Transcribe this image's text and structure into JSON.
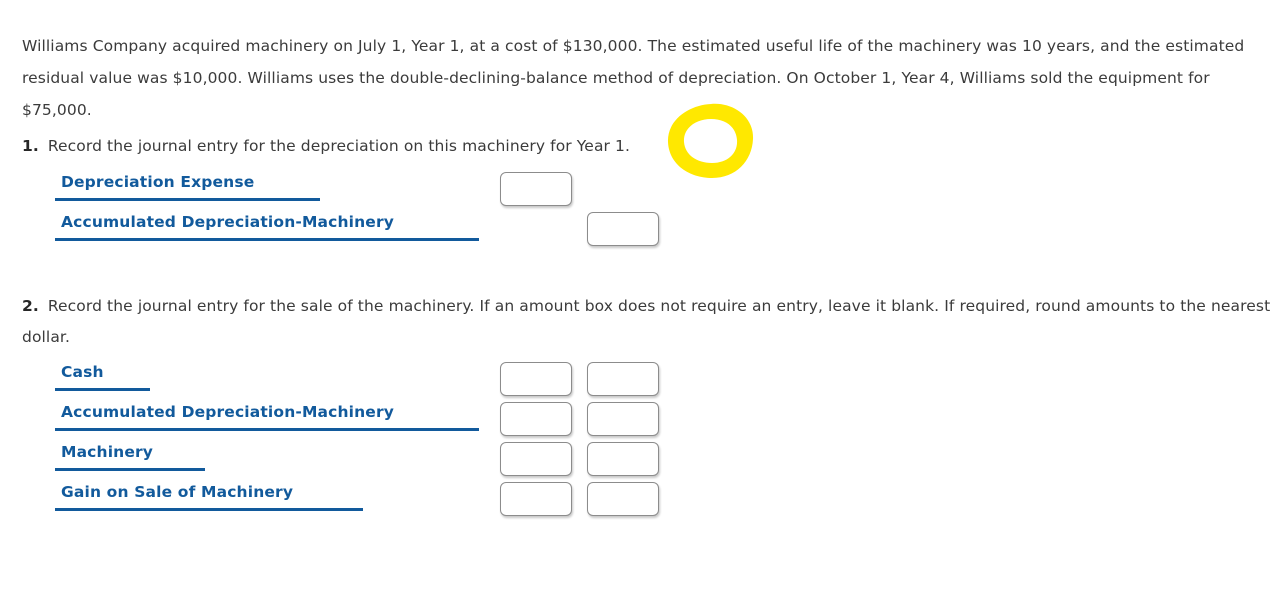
{
  "intro": {
    "text": "Williams Company acquired machinery on July 1, Year 1, at a cost of $130,000. The estimated useful life of the machinery was 10 years, and the estimated residual value was $10,000. Williams uses the double-declining-balance method of depreciation. On October 1, Year 4, Williams sold the equipment for $75,000."
  },
  "questions": [
    {
      "number": "1.",
      "text": "Record the journal entry for the depreciation on this machinery for Year 1.",
      "rows": [
        {
          "label": "Depreciation Expense",
          "rule_width": 265,
          "debit_value": "",
          "credit_value": "",
          "has_debit": true,
          "has_credit": false
        },
        {
          "label": "Accumulated Depreciation-Machinery",
          "rule_width": 424,
          "debit_value": "",
          "credit_value": "",
          "has_debit": false,
          "has_credit": true
        }
      ]
    },
    {
      "number": "2.",
      "text": "Record the journal entry for the sale of the machinery. If an amount box does not require an entry, leave it blank. If required, round amounts to the nearest dollar.",
      "rows": [
        {
          "label": "Cash",
          "rule_width": 95,
          "debit_value": "",
          "credit_value": "",
          "has_debit": true,
          "has_credit": true
        },
        {
          "label": "Accumulated Depreciation-Machinery",
          "rule_width": 424,
          "debit_value": "",
          "credit_value": "",
          "has_debit": true,
          "has_credit": true
        },
        {
          "label": "Machinery",
          "rule_width": 150,
          "debit_value": "",
          "credit_value": "",
          "has_debit": true,
          "has_credit": true
        },
        {
          "label": "Gain on Sale of Machinery",
          "rule_width": 308,
          "debit_value": "",
          "credit_value": "",
          "has_debit": true,
          "has_credit": true
        }
      ]
    }
  ],
  "annotation": {
    "type": "hand-drawn-circle",
    "target_text": "Year 1.",
    "color": "#ffe800"
  },
  "colors": {
    "account_link": "#125a9c",
    "body_text": "#3b3b3b",
    "highlight": "#ffe800",
    "box_border": "#8c8c8c"
  }
}
